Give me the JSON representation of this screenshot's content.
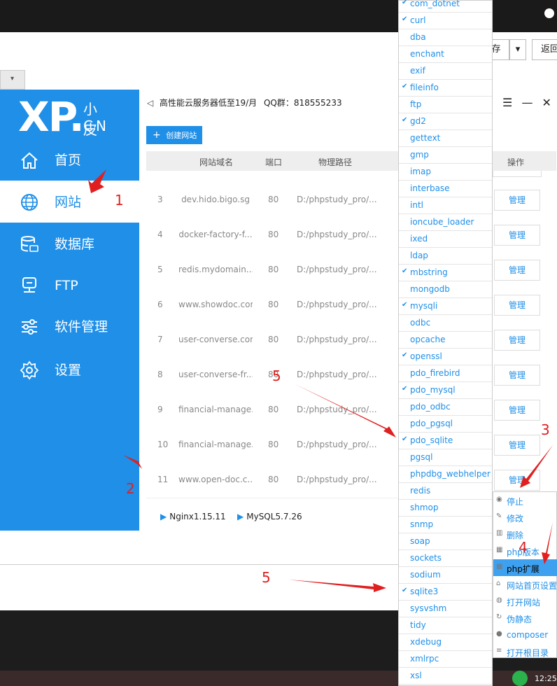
{
  "top": {
    "right_btn_partial": "存",
    "back_btn": "返回",
    "dropdown_arrow": "▾"
  },
  "logo": {
    "xp": "XP.",
    "zh": "小皮",
    "cn": "CN"
  },
  "nav": [
    {
      "label": "首页",
      "icon": "home-icon"
    },
    {
      "label": "网站",
      "icon": "globe-icon"
    },
    {
      "label": "数据库",
      "icon": "database-icon"
    },
    {
      "label": "FTP",
      "icon": "ftp-server-icon"
    },
    {
      "label": "软件管理",
      "icon": "sliders-icon"
    },
    {
      "label": "设置",
      "icon": "gear-icon"
    }
  ],
  "header": {
    "ad_text": "高性能云服务器低至19/月",
    "qq_text": "QQ群：818555233",
    "menu_icon": "☰",
    "min_icon": "—",
    "close_icon": "✕"
  },
  "toolbar": {
    "create_label": "创建网站",
    "create_plus": "+"
  },
  "table": {
    "headers": {
      "domain": "网站域名",
      "port": "端口",
      "path": "物理路径",
      "action": "操作"
    },
    "rows": [
      {
        "no": "3",
        "domain": "dev.hido.bigo.sg",
        "port": "80",
        "path": "D:/phpstudy_pro/..."
      },
      {
        "no": "4",
        "domain": "docker-factory-f...",
        "port": "80",
        "path": "D:/phpstudy_pro/..."
      },
      {
        "no": "5",
        "domain": "redis.mydomain....",
        "port": "80",
        "path": "D:/phpstudy_pro/..."
      },
      {
        "no": "6",
        "domain": "www.showdoc.com",
        "port": "80",
        "path": "D:/phpstudy_pro/..."
      },
      {
        "no": "7",
        "domain": "user-converse.com",
        "port": "80",
        "path": "D:/phpstudy_pro/..."
      },
      {
        "no": "8",
        "domain": "user-converse-fr...",
        "port": "80",
        "path": "D:/phpstudy_pro/..."
      },
      {
        "no": "9",
        "domain": "financial-manage...",
        "port": "80",
        "path": "D:/phpstudy_pro/..."
      },
      {
        "no": "10",
        "domain": "financial-manage...",
        "port": "80",
        "path": "D:/phpstudy_pro/..."
      },
      {
        "no": "11",
        "domain": "www.open-doc.c...",
        "port": "80",
        "path": "D:/phpstudy_pro/..."
      }
    ],
    "manage_label": "管理"
  },
  "status": {
    "nginx": "Nginx1.15.11",
    "mysql": "MySQL5.7.26"
  },
  "extensions": [
    {
      "name": "com_dotnet",
      "checked": true
    },
    {
      "name": "curl",
      "checked": true
    },
    {
      "name": "dba",
      "checked": false
    },
    {
      "name": "enchant",
      "checked": false
    },
    {
      "name": "exif",
      "checked": false
    },
    {
      "name": "fileinfo",
      "checked": true
    },
    {
      "name": "ftp",
      "checked": false
    },
    {
      "name": "gd2",
      "checked": true
    },
    {
      "name": "gettext",
      "checked": false
    },
    {
      "name": "gmp",
      "checked": false
    },
    {
      "name": "imap",
      "checked": false
    },
    {
      "name": "interbase",
      "checked": false
    },
    {
      "name": "intl",
      "checked": false
    },
    {
      "name": "ioncube_loader",
      "checked": false
    },
    {
      "name": "ixed",
      "checked": false
    },
    {
      "name": "ldap",
      "checked": false
    },
    {
      "name": "mbstring",
      "checked": true
    },
    {
      "name": "mongodb",
      "checked": false
    },
    {
      "name": "mysqli",
      "checked": true
    },
    {
      "name": "odbc",
      "checked": false
    },
    {
      "name": "opcache",
      "checked": false
    },
    {
      "name": "openssl",
      "checked": true
    },
    {
      "name": "pdo_firebird",
      "checked": false
    },
    {
      "name": "pdo_mysql",
      "checked": true
    },
    {
      "name": "pdo_odbc",
      "checked": false
    },
    {
      "name": "pdo_pgsql",
      "checked": false
    },
    {
      "name": "pdo_sqlite",
      "checked": true
    },
    {
      "name": "pgsql",
      "checked": false
    },
    {
      "name": "phpdbg_webhelper",
      "checked": false
    },
    {
      "name": "redis",
      "checked": false
    },
    {
      "name": "shmop",
      "checked": false
    },
    {
      "name": "snmp",
      "checked": false
    },
    {
      "name": "soap",
      "checked": false
    },
    {
      "name": "sockets",
      "checked": false
    },
    {
      "name": "sodium",
      "checked": false
    },
    {
      "name": "sqlite3",
      "checked": true
    },
    {
      "name": "sysvshm",
      "checked": false
    },
    {
      "name": "tidy",
      "checked": false
    },
    {
      "name": "xdebug",
      "checked": false
    },
    {
      "name": "xmlrpc",
      "checked": false
    },
    {
      "name": "xsl",
      "checked": false
    }
  ],
  "context_menu": [
    {
      "label": "停止",
      "icon": "stop-icon",
      "highlighted": false
    },
    {
      "label": "修改",
      "icon": "edit-icon",
      "highlighted": false
    },
    {
      "label": "删除",
      "icon": "trash-icon",
      "highlighted": false
    },
    {
      "label": "php版本",
      "icon": "php-icon",
      "highlighted": false
    },
    {
      "label": "php扩展",
      "icon": "php-icon",
      "highlighted": true
    },
    {
      "label": "网站首页设置",
      "icon": "home-icon",
      "highlighted": false
    },
    {
      "label": "打开网站",
      "icon": "globe-icon",
      "highlighted": false
    },
    {
      "label": "伪静态",
      "icon": "refresh-icon",
      "highlighted": false
    },
    {
      "label": "composer",
      "icon": "composer-icon",
      "highlighted": false
    },
    {
      "label": "打开根目录",
      "icon": "folder-icon",
      "highlighted": false
    }
  ],
  "annotations": [
    "1",
    "2",
    "3",
    "4",
    "5",
    "5"
  ],
  "clock": "12:25",
  "colors": {
    "accent": "#1f8fe8",
    "annotation": "#e02020"
  }
}
